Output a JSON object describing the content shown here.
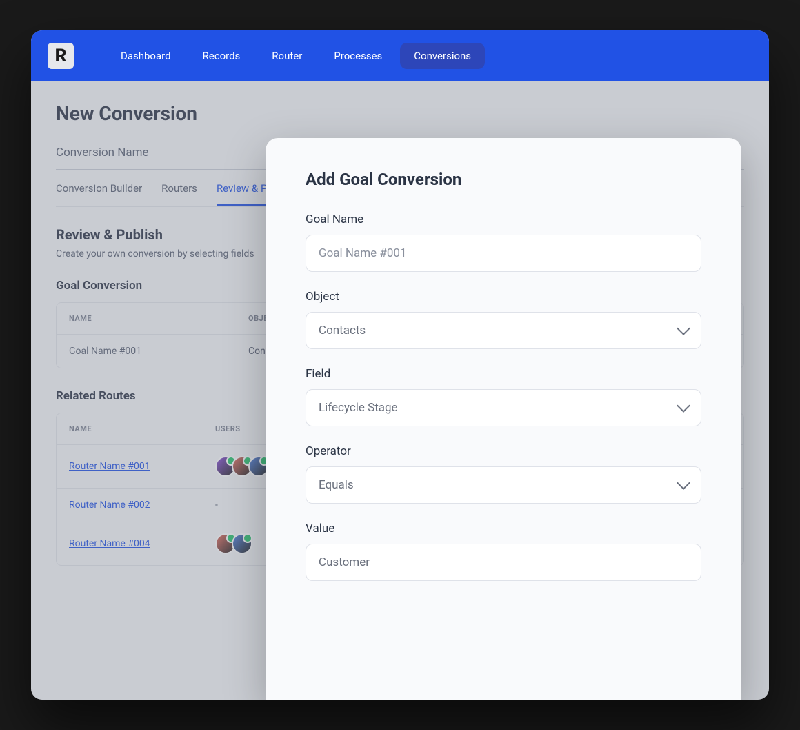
{
  "logo": "R",
  "nav": {
    "items": [
      {
        "label": "Dashboard",
        "active": false
      },
      {
        "label": "Records",
        "active": false
      },
      {
        "label": "Router",
        "active": false
      },
      {
        "label": "Processes",
        "active": false
      },
      {
        "label": "Conversions",
        "active": true
      }
    ]
  },
  "page": {
    "title": "New Conversion",
    "name_placeholder": "Conversion Name",
    "tabs": [
      {
        "label": "Conversion Builder",
        "active": false
      },
      {
        "label": "Routers",
        "active": false
      },
      {
        "label": "Review & Publish",
        "active": true
      }
    ]
  },
  "section": {
    "title": "Review & Publish",
    "desc": "Create your own conversion by selecting fields"
  },
  "goal": {
    "title": "Goal Conversion",
    "headers": {
      "name": "NAME",
      "object": "OBJECT"
    },
    "rows": [
      {
        "name": "Goal Name #001",
        "object": "Contacts"
      }
    ]
  },
  "routes": {
    "title": "Related Routes",
    "headers": {
      "name": "NAME",
      "users": "USERS"
    },
    "rows": [
      {
        "name": "Router Name #001",
        "users_count": 3
      },
      {
        "name": "Router Name #002",
        "users_count": 0,
        "users_text": "-"
      },
      {
        "name": "Router Name #004",
        "users_count": 2
      }
    ]
  },
  "avatar_colors": [
    "#884dd6",
    "#e36b5d",
    "#4c7fe0",
    "#3ca36b",
    "#d34c8c"
  ],
  "modal": {
    "title": "Add Goal Conversion",
    "fields": {
      "goal_name": {
        "label": "Goal Name",
        "placeholder": "Goal Name #001",
        "value": ""
      },
      "object": {
        "label": "Object",
        "value": "Contacts"
      },
      "field": {
        "label": "Field",
        "value": "Lifecycle Stage"
      },
      "operator": {
        "label": "Operator",
        "value": "Equals"
      },
      "value": {
        "label": "Value",
        "value": "Customer"
      }
    }
  }
}
